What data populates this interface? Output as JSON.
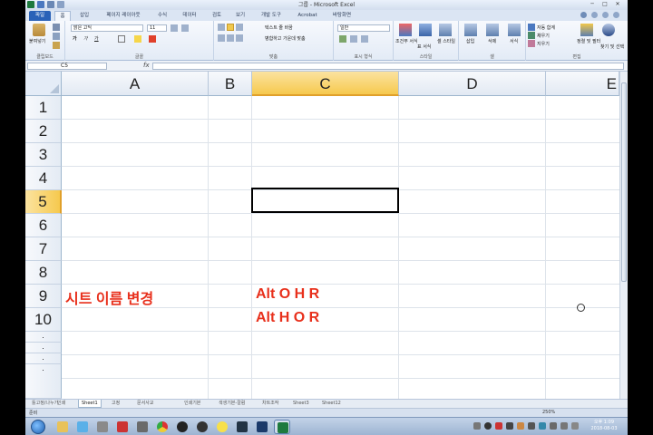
{
  "window": {
    "title": "그룹 - Microsoft Excel",
    "controls": {
      "minimize": "─",
      "maximize": "□",
      "close": "✕"
    }
  },
  "ribbon_tabs": [
    {
      "label": "파일"
    },
    {
      "label": "홈"
    },
    {
      "label": "삽입"
    },
    {
      "label": "페이지 레이아웃"
    },
    {
      "label": "수식"
    },
    {
      "label": "데이터"
    },
    {
      "label": "검토"
    },
    {
      "label": "보기"
    },
    {
      "label": "개발 도구"
    },
    {
      "label": "Acrobat"
    },
    {
      "label": "바탕화면"
    }
  ],
  "ribbon": {
    "clipboard": {
      "paste": "붙여넣기",
      "label": "클립보드"
    },
    "font": {
      "name": "맑은 고딕",
      "size": "11",
      "bold": "가",
      "italic": "가",
      "underline": "가",
      "label": "글꼴"
    },
    "alignment": {
      "wrap": "텍스트 줄 바꿈",
      "merge": "병합하고 가운데 맞춤",
      "label": "맞춤"
    },
    "number": {
      "format": "일반",
      "label": "표시 형식"
    },
    "styles": {
      "conditional": "조건부 서식",
      "table": "표 서식",
      "cell": "셀 스타일",
      "label": "스타일"
    },
    "cells": {
      "insert": "삽입",
      "delete": "삭제",
      "format": "서식",
      "label": "셀"
    },
    "editing": {
      "autosum": "자동 합계",
      "fill": "채우기",
      "clear": "지우기",
      "sort": "정렬 및 필터",
      "find": "찾기 및 선택",
      "label": "편집"
    }
  },
  "formula_bar": {
    "name_box": "C5",
    "fx": "fx",
    "value": ""
  },
  "columns": [
    "A",
    "B",
    "C",
    "D",
    "E"
  ],
  "selected_column": "C",
  "rows": [
    "1",
    "2",
    "3",
    "4",
    "5",
    "6",
    "7",
    "8",
    "9",
    "10",
    "·",
    "·",
    "·",
    "·"
  ],
  "selected_row": "5",
  "cells": {
    "A9": "시트 이름 변경",
    "C9": "Alt O H R",
    "C10": "Alt H O R"
  },
  "sheet_tabs": [
    "틀고정/나누기",
    "인쇄",
    "Sheet1",
    "고정",
    "문서사교",
    "인쇄기본",
    "색생기본-칼럼",
    "차트조작",
    "Sheet3",
    "Sheet12"
  ],
  "status": {
    "text": "준비",
    "zoom": "250%"
  },
  "clock": {
    "time": "오후 1:09",
    "date": "2018-08-03"
  },
  "colors": {
    "accent": "#2a62b8",
    "cell_text": "#e8301c",
    "selected_header": "#f6c94e"
  }
}
